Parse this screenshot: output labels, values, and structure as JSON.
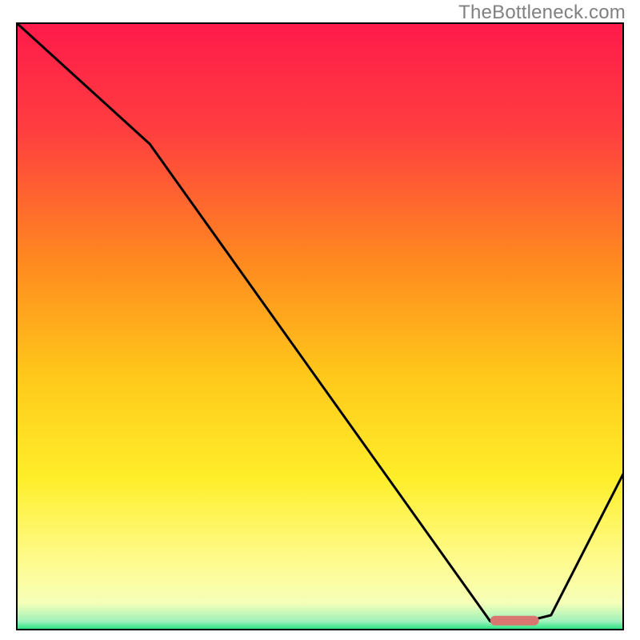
{
  "attribution": "TheBottleneck.com",
  "chart_data": {
    "type": "line",
    "title": "",
    "xlabel": "",
    "ylabel": "",
    "xlim": [
      0,
      100
    ],
    "ylim": [
      0,
      100
    ],
    "x": [
      0,
      22,
      78,
      84,
      88,
      100
    ],
    "values": [
      100,
      80,
      1.5,
      1.5,
      2.5,
      26
    ],
    "optimal_band": {
      "x_start": 78,
      "x_end": 86,
      "y": 1.6
    },
    "gradient_stops": [
      {
        "pos": 0.0,
        "color": "#ff1a4b"
      },
      {
        "pos": 0.18,
        "color": "#ff3f3f"
      },
      {
        "pos": 0.4,
        "color": "#ff8b1f"
      },
      {
        "pos": 0.58,
        "color": "#ffc81a"
      },
      {
        "pos": 0.75,
        "color": "#ffee2a"
      },
      {
        "pos": 0.88,
        "color": "#fffb8a"
      },
      {
        "pos": 0.955,
        "color": "#f6ffb8"
      },
      {
        "pos": 0.985,
        "color": "#9ff2bb"
      },
      {
        "pos": 1.0,
        "color": "#16e07a"
      }
    ]
  }
}
